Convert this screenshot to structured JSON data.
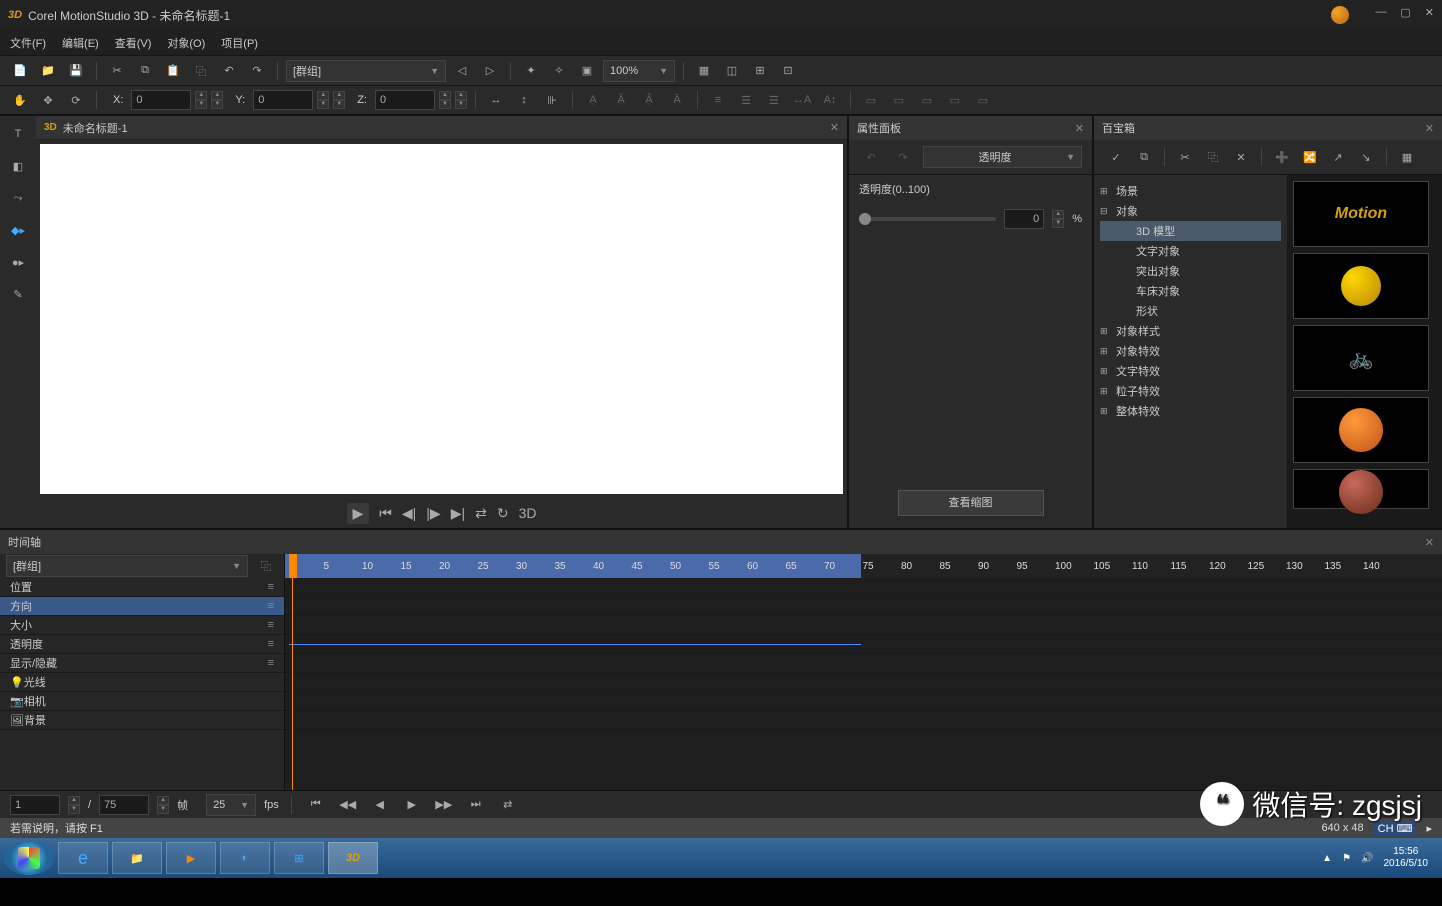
{
  "title": {
    "app": "3D",
    "text": "Corel MotionStudio 3D - 未命名标题-1"
  },
  "menu": {
    "file": "文件(F)",
    "edit": "编辑(E)",
    "view": "查看(V)",
    "object": "对象(O)",
    "project": "项目(P)"
  },
  "toolbar": {
    "group_dd": "[群组]",
    "zoom": "100%"
  },
  "coords": {
    "x_label": "X:",
    "x": "0",
    "y_label": "Y:",
    "y": "0",
    "z_label": "Z:",
    "z": "0"
  },
  "viewtab": {
    "name": "未命名标题-1"
  },
  "playbar": {
    "three_d": "3D"
  },
  "prop_panel": {
    "title": "属性面板",
    "dd": "透明度",
    "opacity_label": "透明度(0..100)",
    "opacity_val": "0",
    "percent": "%",
    "viewthumb": "查看缩图"
  },
  "treasure_panel": {
    "title": "百宝箱"
  },
  "tree": {
    "scene": "场景",
    "object": "对象",
    "model3d": "3D 模型",
    "textobj": "文字对象",
    "extrude": "突出对象",
    "lathe": "车床对象",
    "shape": "形状",
    "objstyle": "对象样式",
    "objfx": "对象特效",
    "textfx": "文字特效",
    "particlefx": "粒子特效",
    "globalfx": "整体特效"
  },
  "timeline": {
    "title": "时间轴",
    "group_dd": "[群组]",
    "tracks": {
      "pos": "位置",
      "dir": "方向",
      "size": "大小",
      "opacity": "透明度",
      "showhide": "显示/隐藏",
      "light": "光线",
      "camera": "相机",
      "bg": "背景"
    },
    "foot": {
      "frame": "1",
      "slash": "/",
      "total": "75",
      "unit": "帧",
      "fps_v": "25",
      "fps_l": "fps"
    }
  },
  "status": {
    "hint": "若需说明，请按 F1",
    "dims": "640 x 48"
  },
  "taskbar": {
    "time": "15:56",
    "date": "2016/5/10",
    "lang": "CH"
  },
  "watermark": {
    "text": "微信号: zgsjsj"
  },
  "ruler_marks": [
    1,
    5,
    10,
    15,
    20,
    25,
    30,
    35,
    40,
    45,
    50,
    55,
    60,
    65,
    70,
    75,
    80,
    85,
    90,
    95,
    100,
    105,
    110,
    115,
    120,
    125,
    130,
    135,
    140
  ]
}
